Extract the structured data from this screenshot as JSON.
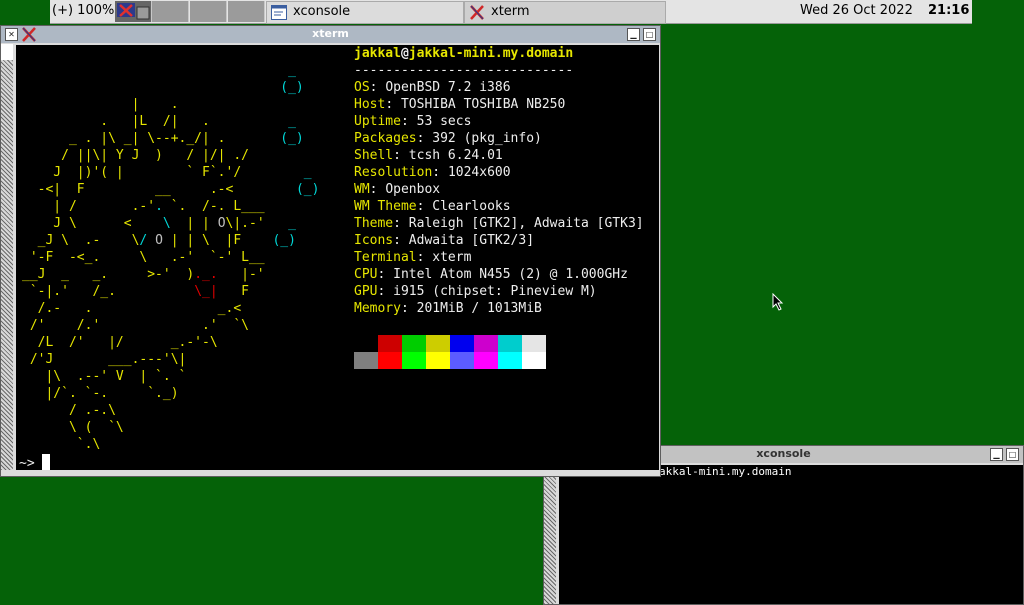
{
  "panel": {
    "zoom_label": "(+) 100%",
    "tasks": [
      {
        "label": "xconsole",
        "icon": "xconsole-window-icon"
      },
      {
        "label": "xterm",
        "icon": "xterm-x-icon"
      }
    ],
    "date": "Wed 26 Oct 2022",
    "time": "21:16"
  },
  "xterm": {
    "title": "xterm",
    "prompt": "~>"
  },
  "xconsole": {
    "title": "xconsole",
    "log_text": "akkal-mini.my.domain"
  },
  "neofetch": {
    "user": "jakkal",
    "at": "@",
    "host": "jakkal-mini.my.domain",
    "rule": "----------------------------",
    "info": [
      {
        "key": "OS",
        "value": "OpenBSD 7.2 i386"
      },
      {
        "key": "Host",
        "value": "TOSHIBA TOSHIBA NB250"
      },
      {
        "key": "Uptime",
        "value": "53 secs"
      },
      {
        "key": "Packages",
        "value": "392 (pkg_info)"
      },
      {
        "key": "Shell",
        "value": "tcsh 6.24.01"
      },
      {
        "key": "Resolution",
        "value": "1024x600"
      },
      {
        "key": "WM",
        "value": "Openbox"
      },
      {
        "key": "WM Theme",
        "value": "Clearlooks"
      },
      {
        "key": "Theme",
        "value": "Raleigh [GTK2], Adwaita [GTK3]"
      },
      {
        "key": "Icons",
        "value": "Adwaita [GTK2/3]"
      },
      {
        "key": "Terminal",
        "value": "xterm"
      },
      {
        "key": "CPU",
        "value": "Intel Atom N455 (2) @ 1.000GHz"
      },
      {
        "key": "GPU",
        "value": "i915 (chipset: Pineview M)"
      },
      {
        "key": "Memory",
        "value": "201MiB / 1013MiB"
      }
    ],
    "palette_row1": [
      "#000000",
      "#cd0000",
      "#00cd00",
      "#cdcd00",
      "#0000ee",
      "#cd00cd",
      "#00cdcd",
      "#e5e5e5"
    ],
    "palette_row2": [
      "#7f7f7f",
      "#ff0000",
      "#00ff00",
      "#ffff00",
      "#5c5cff",
      "#ff00ff",
      "#00ffff",
      "#ffffff"
    ]
  },
  "colors": {
    "desktop": "#056208",
    "key": "#e6e600",
    "text": "#eeeeee"
  }
}
